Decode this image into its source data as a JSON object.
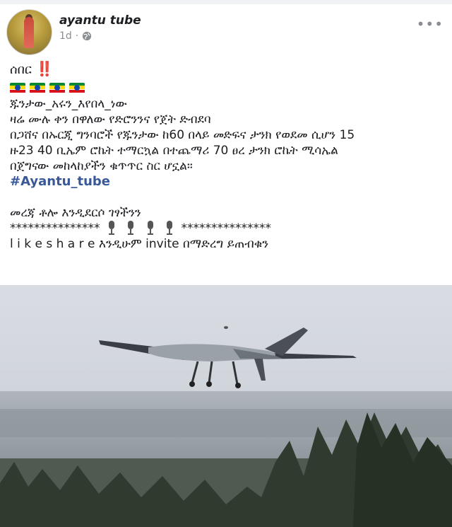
{
  "post": {
    "page_name": "ayantu tube",
    "time": "1d",
    "privacy_icon": "globe-icon",
    "more_icon": "more-options-icon"
  },
  "text": {
    "title": "ሰበር",
    "title_emoji": "‼️",
    "flags_icon": "ethiopian-flag-icon",
    "line1": "ጁንታው_አሩን_እየበላ_ነው",
    "line2": "ዛሬ ሙሉ ቀን በዋለው የድሮንንና የጀት ድብደባ",
    "line3": "በጋሸና በኡርጂ ግንባሮች የጁንታው ከ60 በላይ መድፍና ታንክ የወደመ ሲሆን 15",
    "line4": "ዙ23   40 ቢኤም  ሮኬት ተማርኳል በተጨማሪ 70 ፀረ ታንክ ሮኬት ሚሳኤል",
    "line5": "በጀግናው መከላከያችን ቁጥጥር ስር ሆኗል።",
    "hashtag": "#Ayantu_tube",
    "line6": "መረጃ ቶሎ እንዲደርሶ ገፃችንን",
    "stars_left": "***************",
    "mic_icon": "microphone-icon",
    "stars_right": "***************",
    "line7": "l i k e  s h a r e እንዲሁም invite በማድረግ ይጠብቁን"
  },
  "image": {
    "subject": "drone-photo"
  }
}
